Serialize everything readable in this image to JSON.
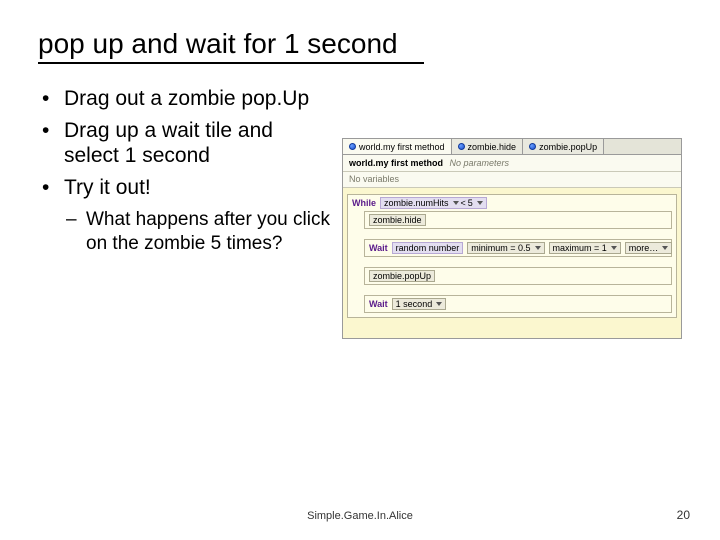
{
  "title": "pop up and wait for 1 second",
  "bullets": [
    "Drag out a zombie pop.Up",
    "Drag up a wait tile and select 1 second",
    "Try it out!"
  ],
  "sub_bullet": "What happens after you click on the zombie 5 times?",
  "alice": {
    "tabs": [
      "world.my first method",
      "zombie.hide",
      "zombie.popUp"
    ],
    "method_label": "world.my first method",
    "method_params": "No parameters",
    "no_vars": "No variables",
    "while_kw": "While",
    "cond_left": "zombie.numHits",
    "cond_op": "<",
    "cond_right": "5",
    "line1": "zombie.hide",
    "wait_kw": "Wait",
    "rand_label": "random number",
    "min_label": "minimum = 0.5",
    "max_label": "maximum = 1",
    "more_label": "more…",
    "line3": "zombie.popUp",
    "wait2_val": "1 second"
  },
  "footer": "Simple.Game.In.Alice",
  "page_number": "20"
}
